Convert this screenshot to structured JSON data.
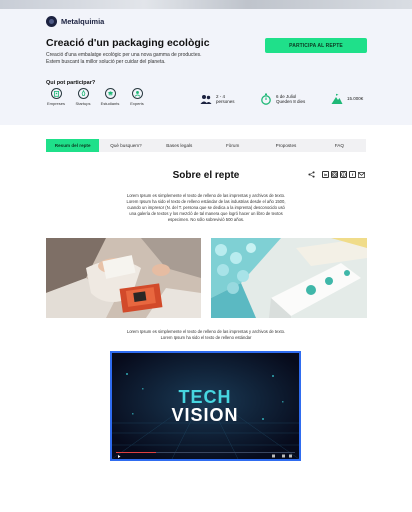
{
  "brand": {
    "name": "Metalquimia"
  },
  "hero": {
    "title": "Creació d'un packaging ecològic",
    "description": "Creació d'una embalatge ecològic per una nova gamma de productes. Estem buscant la millor solució per cuidar del planeta.",
    "cta_label": "PARTICIPA AL REPTE"
  },
  "participants": {
    "heading": "Qui pot participar?",
    "categories": [
      {
        "label": "Empreses",
        "icon": "building-icon"
      },
      {
        "label": "Startups",
        "icon": "rocket-icon"
      },
      {
        "label": "Estudiants",
        "icon": "graduation-cap-icon"
      },
      {
        "label": "Experts",
        "icon": "expert-icon"
      }
    ]
  },
  "stats": {
    "team_size": {
      "line1": "2 - 4",
      "line2": "persones",
      "icon": "people-icon"
    },
    "deadline": {
      "line1": "6 de Juliol",
      "line2": "Queden 8 dies",
      "icon": "stopwatch-icon"
    },
    "prize": {
      "line1": "15.000€",
      "icon": "mountain-flag-icon"
    }
  },
  "tabs": [
    {
      "label": "Resum del repte",
      "active": true
    },
    {
      "label": "Què busquem?",
      "active": false
    },
    {
      "label": "Bases legals",
      "active": false
    },
    {
      "label": "Fòrum",
      "active": false
    },
    {
      "label": "Propostes",
      "active": false
    },
    {
      "label": "FAQ",
      "active": false
    }
  ],
  "section": {
    "title": "Sobre el repte",
    "paragraph1": "Lorem Ipsum es simplemente el texto de relleno de las imprentas y archivos de texto. Lorem Ipsum ha sido el texto de relleno estándar de las industrias desde el año 1500, cuando un impresor (N. del T. persona que se dedica a la imprenta) desconocido usó una galería de textos y los mezcló de tal manera que logró hacer un libro de textos especimen. No sólo sobrevivió 500 años.",
    "paragraph2": "Lorem Ipsum es simplemente el texto de relleno de las imprentas y archivos de texto. Lorem Ipsum ha sido el texto de relleno estándar"
  },
  "video": {
    "line1": "TECH",
    "line2": "VISION"
  },
  "colors": {
    "accent": "#1fe08a",
    "brand_dark": "#1c2240",
    "video_border": "#2f6cf0"
  }
}
